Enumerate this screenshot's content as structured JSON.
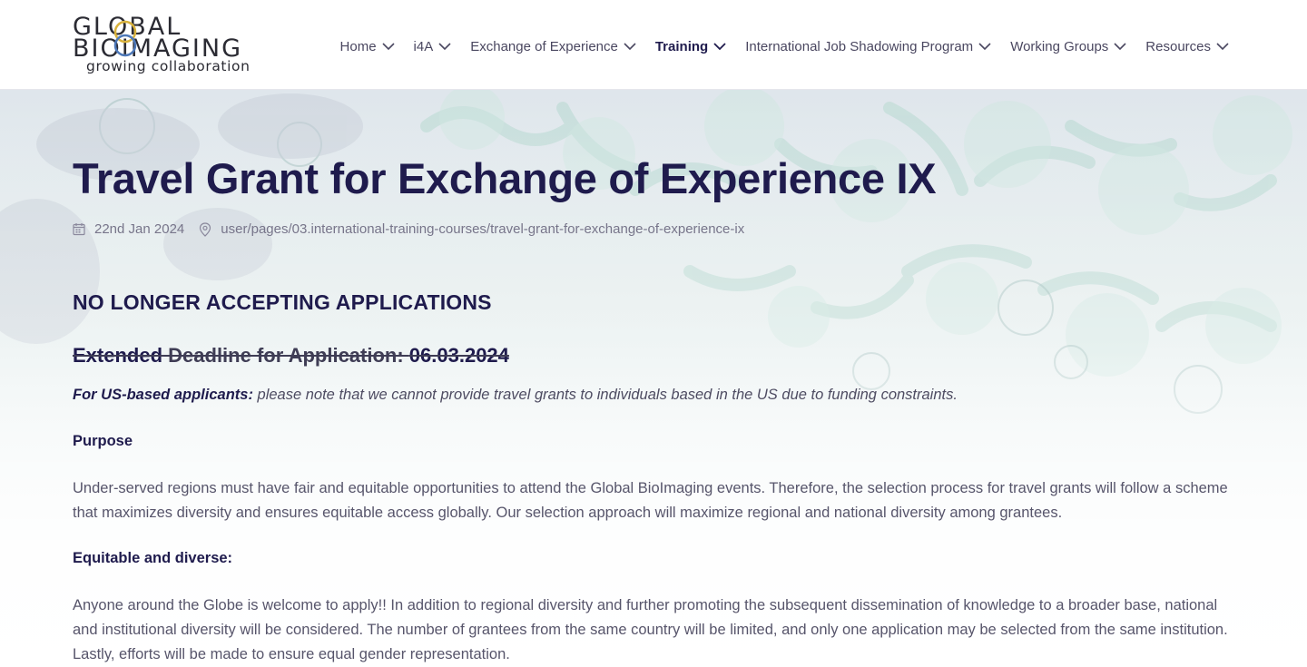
{
  "logo": {
    "line1": "GLOBAL",
    "line2": "BIOIMAGING",
    "tagline": "growing collaboration"
  },
  "nav": {
    "items": [
      {
        "label": "Home"
      },
      {
        "label": "i4A"
      },
      {
        "label": "Exchange of Experience"
      },
      {
        "label": "Training",
        "active": true
      },
      {
        "label": "International Job Shadowing Program"
      },
      {
        "label": "Working Groups"
      },
      {
        "label": "Resources"
      }
    ],
    "icon": "chevron-down-icon"
  },
  "page": {
    "title": "Travel Grant for Exchange of Experience IX",
    "date": "22nd Jan 2024",
    "date_icon": "calendar-icon",
    "path": "user/pages/03.international-training-courses/travel-grant-for-exchange-of-experience-ix",
    "path_icon": "location-pin-icon",
    "notice": "NO LONGER ACCEPTING APPLICATIONS",
    "deadline": {
      "extended": "Extended",
      "label": " Deadline for Application: ",
      "date": "06.03.2024"
    },
    "us_note": {
      "lead": "For US-based applicants:",
      "text": " please note that we cannot provide travel grants to individuals based in the US due to funding constraints."
    },
    "sections": [
      {
        "heading": "Purpose",
        "text": "Under-served regions must have fair and equitable opportunities to attend the Global BioImaging events. Therefore, the selection process for travel grants will follow a scheme that maximizes diversity and ensures equitable access globally. Our selection approach will maximize regional and national diversity among grantees."
      },
      {
        "heading": "Equitable and diverse:",
        "text": "Anyone around the Globe is welcome to apply!! In addition to regional diversity and further promoting the subsequent dissemination of knowledge to a broader base, national and institutional diversity will be considered. The number of grantees from the same country will be limited, and only one application may be selected from the same institution. Lastly, efforts will be made to ensure equal gender representation."
      }
    ]
  },
  "colors": {
    "heading": "#1f1b4d",
    "body": "#57556b",
    "logo_gold": "#d9b23c",
    "logo_blue": "#4d78b8"
  }
}
